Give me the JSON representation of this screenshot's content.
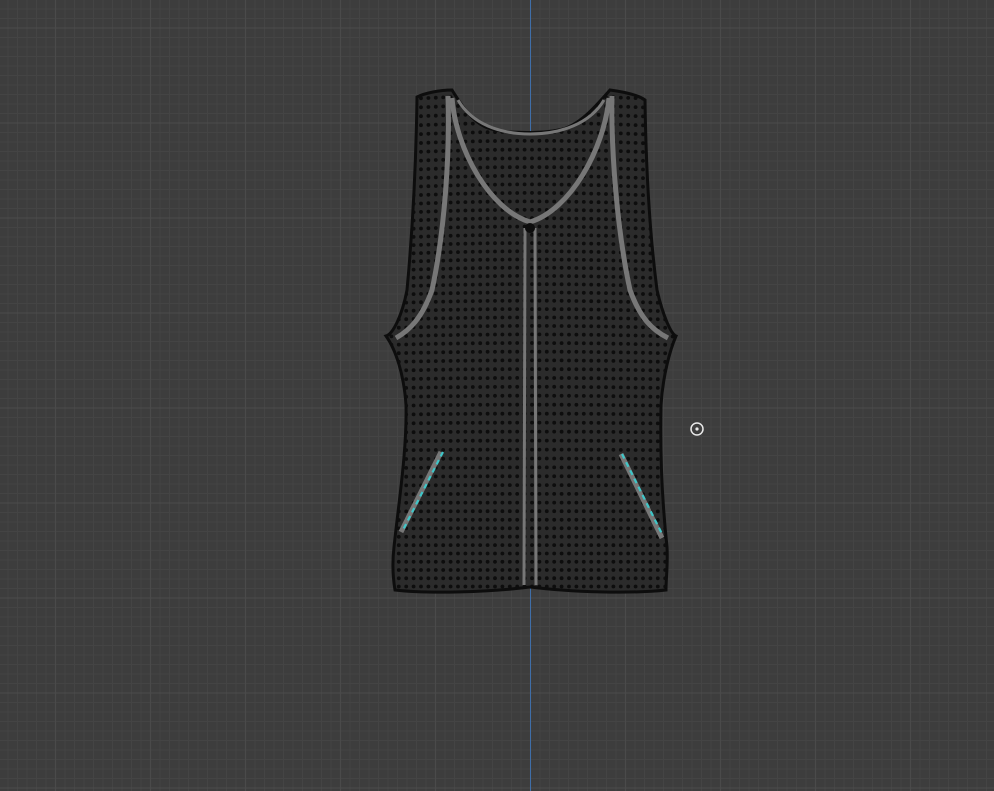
{
  "viewport": {
    "mode": "edit-mode-vertex-view",
    "background_color": "#3d3d3d",
    "grid_minor_color": "#444444",
    "grid_major_color": "#4a4a4a",
    "axis_color": "#3f6ea8"
  },
  "mesh": {
    "object_kind": "tank-top-vest",
    "surface_color": "#2b2b2b",
    "vertex_color": "#0d0d0d",
    "trim_color": "#777777",
    "selected_edge_color": "#3fc6c8"
  },
  "cursor_3d": {
    "icon": "3d-cursor-icon",
    "color": "#e8e8e8"
  }
}
